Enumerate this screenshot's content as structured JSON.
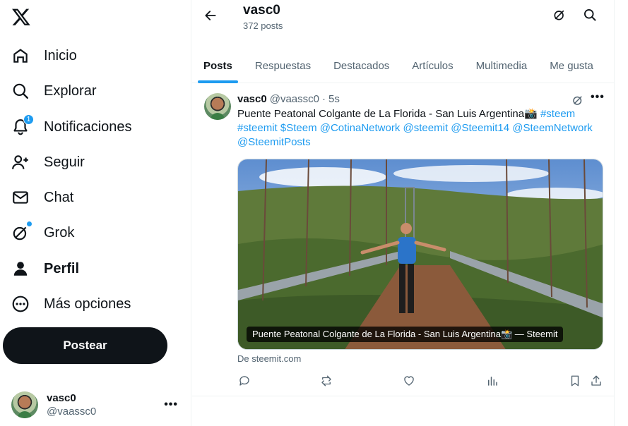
{
  "sidebar": {
    "logo_icon": "x-logo-icon",
    "items": [
      {
        "label": "Inicio",
        "icon": "home-icon"
      },
      {
        "label": "Explorar",
        "icon": "search-icon"
      },
      {
        "label": "Notificaciones",
        "icon": "bell-icon",
        "badge": "1"
      },
      {
        "label": "Seguir",
        "icon": "add-person-icon"
      },
      {
        "label": "Chat",
        "icon": "mail-icon"
      },
      {
        "label": "Grok",
        "icon": "grok-icon"
      },
      {
        "label": "Perfil",
        "icon": "person-icon"
      },
      {
        "label": "Más opciones",
        "icon": "more-circle-icon"
      }
    ],
    "post_button": "Postear",
    "account": {
      "name": "vasc0",
      "handle": "@vaassc0",
      "more": "•••"
    }
  },
  "header": {
    "name": "vasc0",
    "post_count": "372 posts"
  },
  "tabs": [
    "Posts",
    "Respuestas",
    "Destacados",
    "Artículos",
    "Multimedia",
    "Me gusta"
  ],
  "post": {
    "author": "vasc0",
    "handle": "@vaassc0",
    "dot": "·",
    "time": "5s",
    "more": "•••",
    "text_plain": "Puente Peatonal Colgante de La Florida - San Luis Argentina📸",
    "hashtags": [
      "#steem",
      "#steemit",
      "$Steem",
      "@CotinaNetwork",
      "@steemit",
      "@Steemit14",
      "@SteemNetwork",
      "@SteemitPosts"
    ],
    "media_caption": "Puente Peatonal Colgante de La Florida - San Luis Argentina📸 — Steemit",
    "source": "De steemit.com"
  },
  "colors": {
    "accent": "#1d9bf0",
    "text": "#0f1419",
    "muted": "#536471",
    "button": "#0f1419"
  }
}
